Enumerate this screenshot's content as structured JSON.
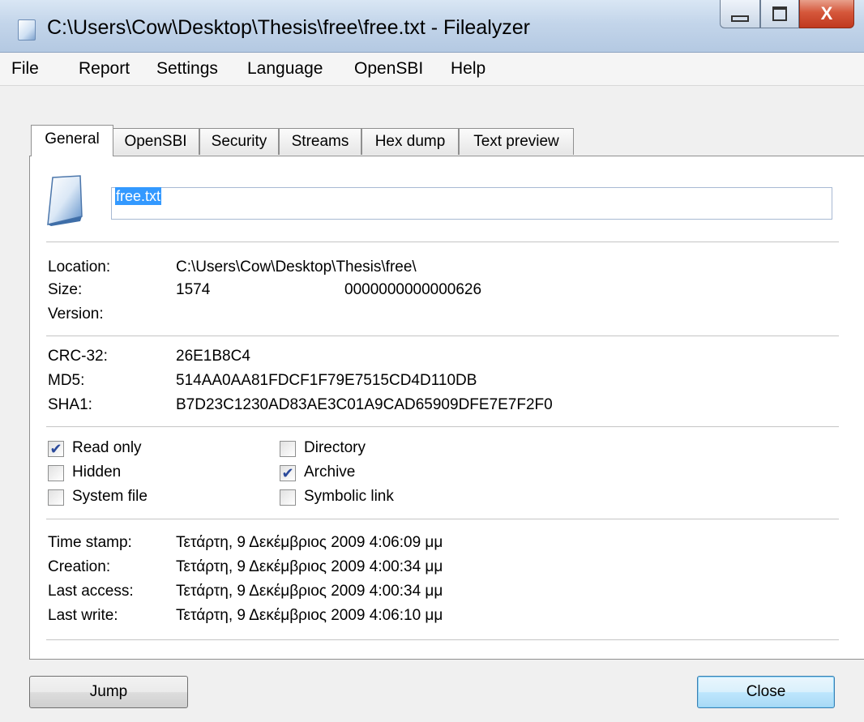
{
  "window": {
    "title": "C:\\Users\\Cow\\Desktop\\Thesis\\free\\free.txt - Filealyzer",
    "close_glyph": "X"
  },
  "menu": [
    "File",
    "Report",
    "Settings",
    "Language",
    "OpenSBI",
    "Help"
  ],
  "tabs": [
    "General",
    "OpenSBI",
    "Security",
    "Streams",
    "Hex dump",
    "Text preview"
  ],
  "active_tab": "General",
  "file": {
    "name": "free.txt",
    "icon": "text-file-icon"
  },
  "info": {
    "location_label": "Location:",
    "location": "C:\\Users\\Cow\\Desktop\\Thesis\\free\\",
    "size_label": "Size:",
    "size": "1574",
    "size_hex": "0000000000000626",
    "version_label": "Version:"
  },
  "hashes": {
    "crc_label": "CRC-32:",
    "crc": "26E1B8C4",
    "md5_label": "MD5:",
    "md5": "514AA0AA81FDCF1F79E7515CD4D110DB",
    "sha1_label": "SHA1:",
    "sha1": "B7D23C1230AD83AE3C01A9CAD65909DFE7E7F2F0"
  },
  "attributes": {
    "read_only": {
      "label": "Read only",
      "checked": true
    },
    "hidden": {
      "label": "Hidden",
      "checked": false
    },
    "system_file": {
      "label": "System file",
      "checked": false
    },
    "directory": {
      "label": "Directory",
      "checked": false
    },
    "archive": {
      "label": "Archive",
      "checked": true
    },
    "symbolic_link": {
      "label": "Symbolic link",
      "checked": false
    }
  },
  "times": {
    "timestamp_label": "Time stamp:",
    "timestamp": "Τετάρτη, 9 Δεκέμβριος 2009 4:06:09 μμ",
    "creation_label": "Creation:",
    "creation": "Τετάρτη, 9 Δεκέμβριος 2009 4:00:34 μμ",
    "last_access_label": "Last access:",
    "last_access": "Τετάρτη, 9 Δεκέμβριος 2009 4:00:34 μμ",
    "last_write_label": "Last write:",
    "last_write": "Τετάρτη, 9 Δεκέμβριος 2009 4:06:10 μμ"
  },
  "buttons": {
    "jump": "Jump",
    "close": "Close"
  },
  "colors": {
    "selection": "#3399ff",
    "check": "#2b4a9b",
    "close_button": "#c0391f"
  }
}
